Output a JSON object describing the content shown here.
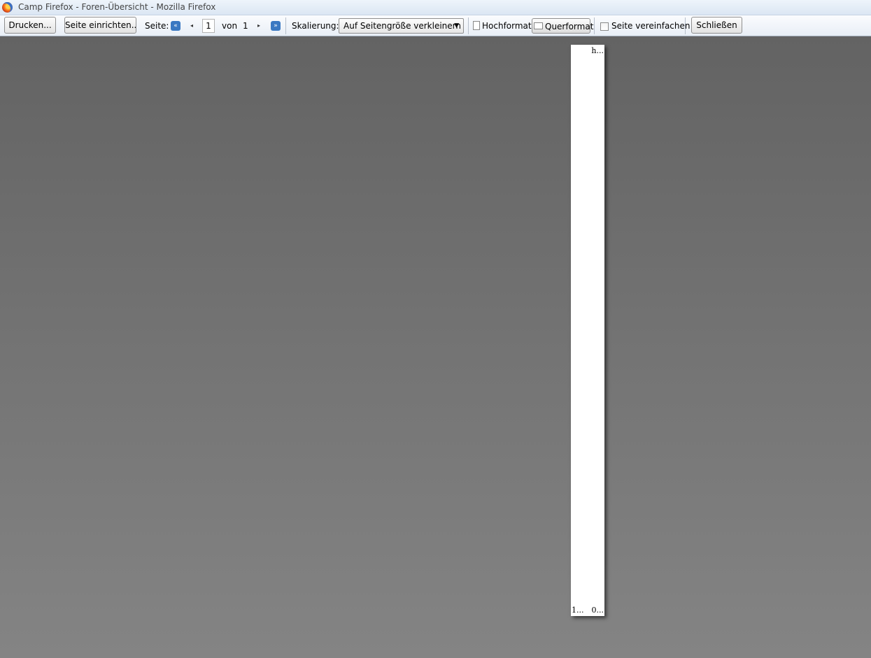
{
  "window": {
    "title": "Camp Firefox - Foren-Übersicht - Mozilla Firefox"
  },
  "toolbar": {
    "print_label": "Drucken...",
    "page_setup_label": "Seite einrichten...",
    "page_label": "Seite:",
    "current_page": "1",
    "of_label": "von",
    "total_pages": "1",
    "scale_label": "Skalierung:",
    "scale_value": "Auf Seitengröße verkleinern",
    "portrait_label": "Hochformat",
    "landscape_label": "Querformat",
    "simplify_label": "Seite vereinfachen",
    "close_label": "Schließen"
  },
  "preview": {
    "header_right": "h...",
    "footer_left": "1...",
    "footer_right": "0..."
  }
}
